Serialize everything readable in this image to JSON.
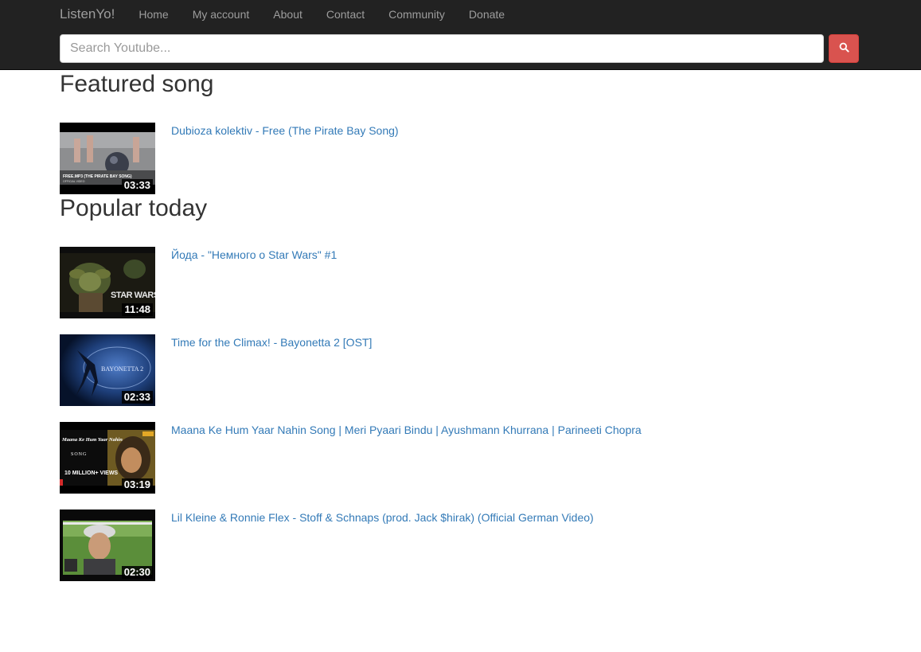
{
  "nav": {
    "brand": "ListenYo!",
    "links": [
      "Home",
      "My account",
      "About",
      "Contact",
      "Community",
      "Donate"
    ]
  },
  "search": {
    "placeholder": "Search Youtube...",
    "button_icon": "search-icon"
  },
  "featured": {
    "heading": "Featured song",
    "item": {
      "title": "Dubioza kolektiv - Free (The Pirate Bay Song)",
      "duration": "03:33",
      "thumb_text": "FREE.MP3 (THE PIRATE BAY SONG)",
      "thumb_subtext": "OFFICIAL VIDEO"
    }
  },
  "popular": {
    "heading": "Popular today",
    "items": [
      {
        "title": "Йода - \"Немного о Star Wars\" #1",
        "duration": "11:48",
        "thumb_text": "STAR WARS"
      },
      {
        "title": "Time for the Climax! - Bayonetta 2 [OST]",
        "duration": "02:33",
        "thumb_text": "BAYONETTA 2"
      },
      {
        "title": "Maana Ke Hum Yaar Nahin Song | Meri Pyaari Bindu | Ayushmann Khurrana | Parineeti Chopra",
        "duration": "03:19",
        "thumb_text": "Maana Ke Hum Yaar Nahin",
        "thumb_subtext": "SONG",
        "thumb_views": "10 MILLION+ VIEWS"
      },
      {
        "title": "Lil Kleine & Ronnie Flex - Stoff & Schnaps (prod. Jack $hirak) (Official German Video)",
        "duration": "02:30",
        "thumb_text": ""
      }
    ]
  },
  "colors": {
    "navbar_bg": "#222222",
    "link": "#337ab7",
    "search_button": "#d9534f"
  }
}
